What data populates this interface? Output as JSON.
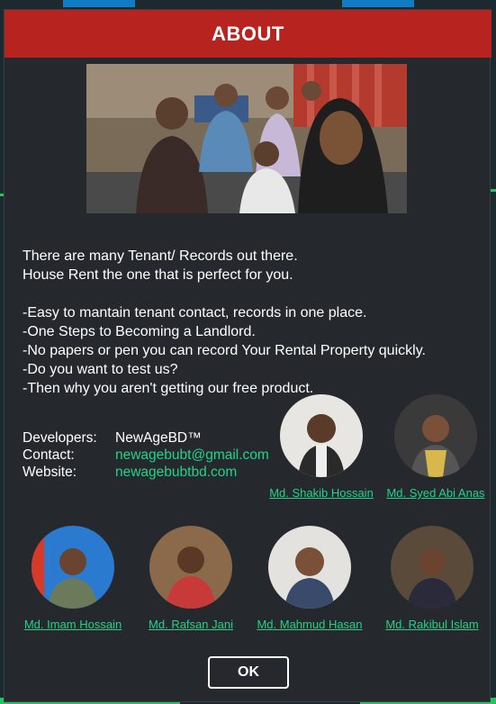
{
  "dialog": {
    "title": "ABOUT",
    "description": [
      "There are many Tenant/ Records out there.",
      "House Rent the one that is perfect for you.",
      "",
      "-Easy to mantain tenant contact, records in one place.",
      "-One Steps to Becoming a Landlord.",
      "-No papers or pen you can record Your Rental Property quickly.",
      "-Do you want to test us?",
      "-Then why you aren't getting our free product."
    ],
    "info": {
      "developers_label": "Developers:",
      "developers_value": "NewAgeBD™",
      "contact_label": "Contact:",
      "contact_value": "newagebubt@gmail.com",
      "website_label": "Website:",
      "website_value": "newagebubtbd.com"
    },
    "team": [
      {
        "name": "Md. Shakib Hossain",
        "icon": "avatar-photo"
      },
      {
        "name": "Md. Syed Abi Anas",
        "icon": "avatar-photo"
      },
      {
        "name": "Md. Imam Hossain",
        "icon": "avatar-photo"
      },
      {
        "name": "Md. Rafsan Jani",
        "icon": "avatar-photo"
      },
      {
        "name": "Md. Mahmud Hasan",
        "icon": "avatar-photo"
      },
      {
        "name": "Md. Rakibul Islam",
        "icon": "avatar-photo"
      }
    ],
    "ok_label": "OK"
  },
  "colors": {
    "title_bar": "#b7231f",
    "dialog_bg": "#25292e",
    "link_green": "#22d38a",
    "text": "#ffffff"
  }
}
